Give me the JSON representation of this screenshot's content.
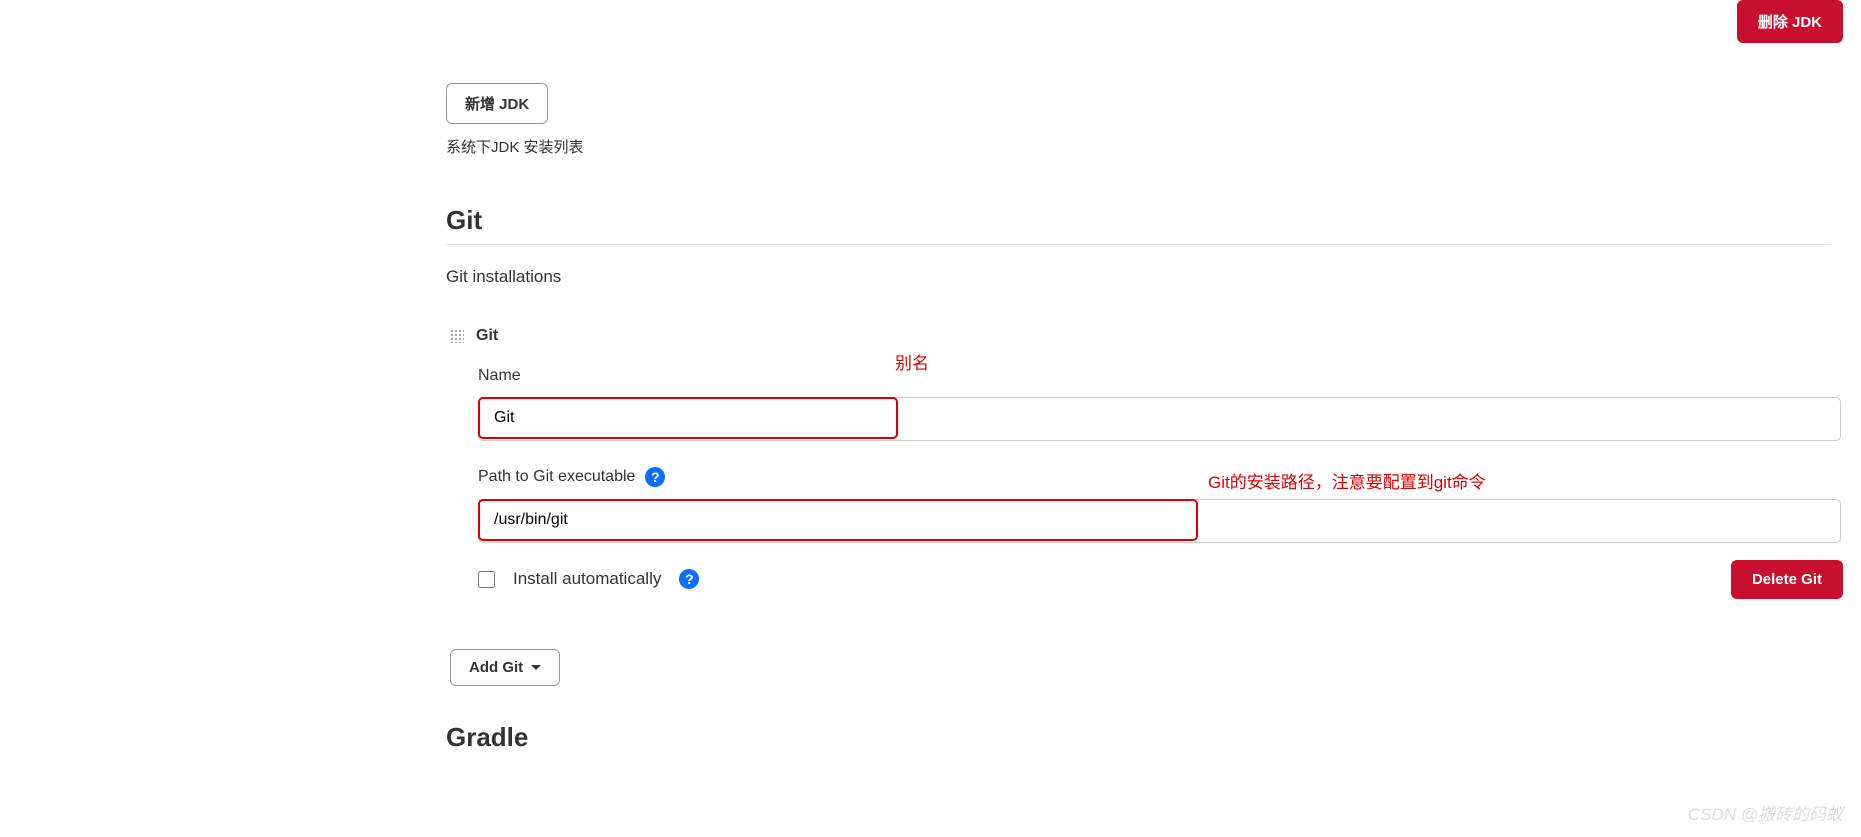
{
  "jdk": {
    "delete_button": "删除 JDK",
    "add_button": "新增 JDK",
    "list_text": "系统下JDK 安装列表"
  },
  "git": {
    "section_title": "Git",
    "installations_label": "Git installations",
    "item_label": "Git",
    "name_label": "Name",
    "name_value": "Git",
    "path_label": "Path to Git executable",
    "path_value": "/usr/bin/git",
    "install_auto_label": "Install automatically",
    "delete_button": "Delete Git",
    "add_button": "Add Git"
  },
  "annotations": {
    "name": "别名",
    "path": "Git的安装路径，注意要配置到git命令"
  },
  "gradle": {
    "section_title": "Gradle"
  },
  "watermark": "CSDN @搬砖的码蚁"
}
